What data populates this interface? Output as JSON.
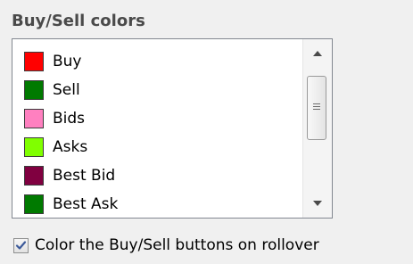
{
  "section_title": "Buy/Sell colors",
  "colors_list": {
    "items": [
      {
        "label": "Buy",
        "color": "#ff0000"
      },
      {
        "label": "Sell",
        "color": "#007a00"
      },
      {
        "label": "Bids",
        "color": "#ff80c0"
      },
      {
        "label": "Asks",
        "color": "#80ff00"
      },
      {
        "label": "Best Bid",
        "color": "#800040"
      },
      {
        "label": "Best Ask",
        "color": "#007a00"
      }
    ]
  },
  "scrollbar": {
    "up_icon": "chevron-up-icon",
    "down_icon": "chevron-down-icon"
  },
  "rollover_option": {
    "label": "Color the Buy/Sell buttons on rollover",
    "checked": true,
    "check_color": "#3c5a9a"
  }
}
